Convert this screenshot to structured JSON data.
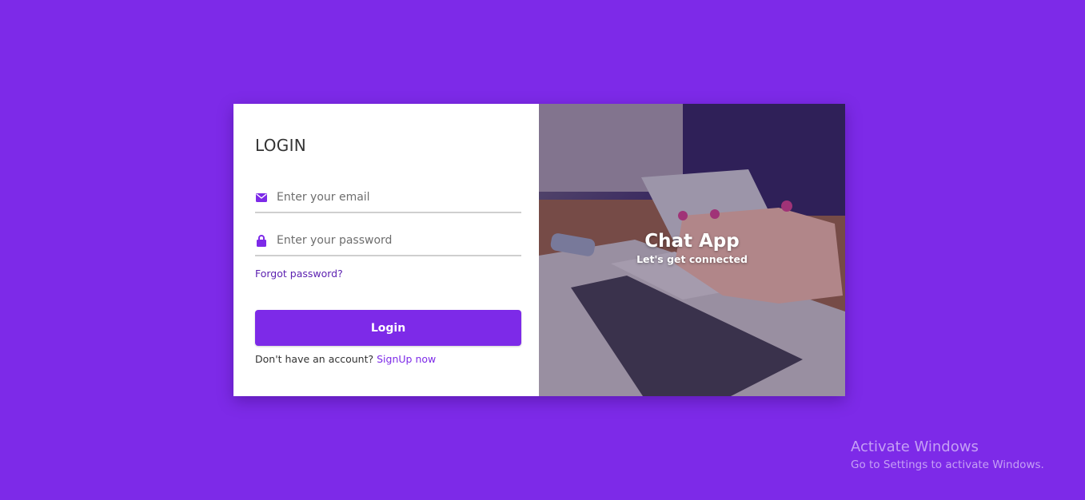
{
  "login": {
    "title": "LOGIN",
    "email_placeholder": "Enter your email",
    "password_placeholder": "Enter your password",
    "forgot_link": "Forgot password?",
    "submit_label": "Login",
    "signup_prompt": "Don't have an account?",
    "signup_link": "SignUp now"
  },
  "hero": {
    "title": "Chat App",
    "subtitle": "Let's get connected"
  },
  "watermark": {
    "title": "Activate Windows",
    "subtitle": "Go to Settings to activate Windows."
  },
  "icons": {
    "email": "envelope-icon",
    "password": "lock-icon"
  },
  "colors": {
    "background": "#7d2ae8",
    "accent": "#7d2ae8",
    "link": "#5b1fb0",
    "card": "#ffffff"
  }
}
